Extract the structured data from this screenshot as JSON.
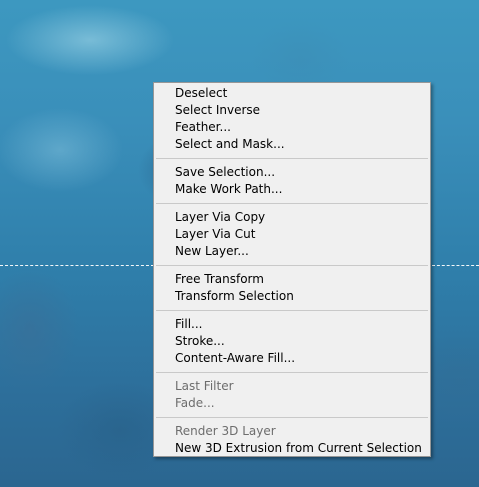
{
  "colors": {
    "menu_background": "#f0f0f0",
    "menu_border": "#979797",
    "text": "#000000",
    "disabled_text": "#6d6d6d",
    "separator": "#c9c9c9",
    "canvas_accent": "#3a8fba"
  },
  "menu": {
    "groups": [
      {
        "items": [
          {
            "label": "Deselect",
            "enabled": true
          },
          {
            "label": "Select Inverse",
            "enabled": true
          },
          {
            "label": "Feather...",
            "enabled": true
          },
          {
            "label": "Select and Mask...",
            "enabled": true
          }
        ]
      },
      {
        "items": [
          {
            "label": "Save Selection...",
            "enabled": true
          },
          {
            "label": "Make Work Path...",
            "enabled": true
          }
        ]
      },
      {
        "items": [
          {
            "label": "Layer Via Copy",
            "enabled": true
          },
          {
            "label": "Layer Via Cut",
            "enabled": true
          },
          {
            "label": "New Layer...",
            "enabled": true
          }
        ]
      },
      {
        "items": [
          {
            "label": "Free Transform",
            "enabled": true
          },
          {
            "label": "Transform Selection",
            "enabled": true
          }
        ]
      },
      {
        "items": [
          {
            "label": "Fill...",
            "enabled": true
          },
          {
            "label": "Stroke...",
            "enabled": true
          },
          {
            "label": "Content-Aware Fill...",
            "enabled": true
          }
        ]
      },
      {
        "items": [
          {
            "label": "Last Filter",
            "enabled": false
          },
          {
            "label": "Fade...",
            "enabled": false
          }
        ]
      },
      {
        "items": [
          {
            "label": "Render 3D Layer",
            "enabled": false
          },
          {
            "label": "New 3D Extrusion from Current Selection",
            "enabled": true
          }
        ]
      }
    ]
  }
}
